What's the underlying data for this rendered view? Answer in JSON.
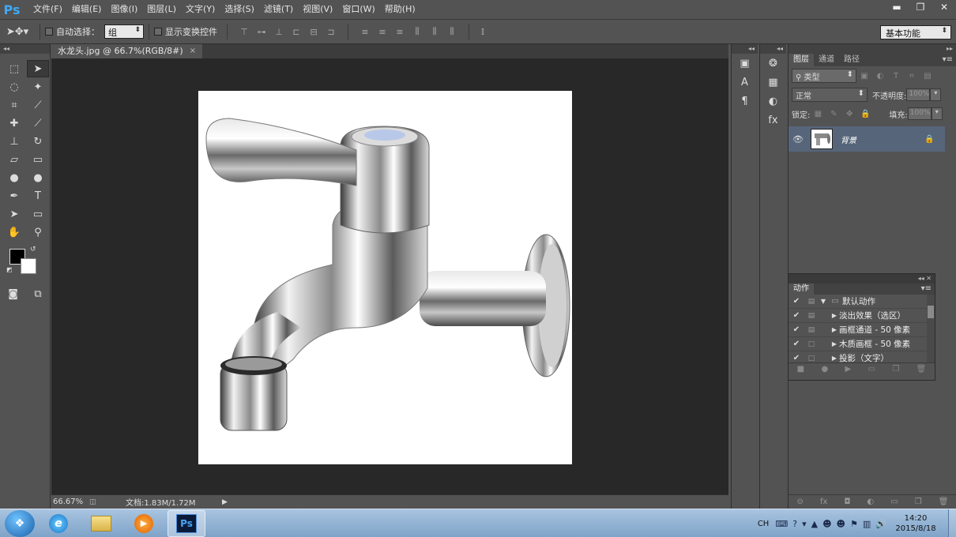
{
  "app": {
    "logo": "Ps"
  },
  "menu": [
    "文件(F)",
    "编辑(E)",
    "图像(I)",
    "图层(L)",
    "文字(Y)",
    "选择(S)",
    "滤镜(T)",
    "视图(V)",
    "窗口(W)",
    "帮助(H)"
  ],
  "window_controls": {
    "minimize": "▬",
    "restore": "❐",
    "close": "✕"
  },
  "options": {
    "tool_icon": "move-tool-icon",
    "auto_select_label": "自动选择：",
    "auto_select_value": "组",
    "show_transform_label": "显示变换控件",
    "workspace": "基本功能"
  },
  "document": {
    "tab_title": "水龙头.jpg @ 66.7%(RGB/8#)",
    "tab_close": "×",
    "zoom": "66.67%",
    "doc_info": "文档:1.83M/1.72M"
  },
  "layers_panel": {
    "tabs": [
      "图层",
      "通道",
      "路径"
    ],
    "filter_kind": "类型",
    "blend_mode": "正常",
    "opacity_label": "不透明度:",
    "opacity_value": "100%",
    "lock_label": "锁定:",
    "fill_label": "填充:",
    "fill_value": "100%",
    "layers": [
      {
        "name": "背景",
        "visible": true,
        "locked": true,
        "selected": true
      }
    ]
  },
  "actions_panel": {
    "title": "动作",
    "items": [
      {
        "label": "默认动作",
        "type": "set",
        "checked": true,
        "expanded": true
      },
      {
        "label": "淡出效果（选区）",
        "type": "action",
        "checked": true,
        "dialog": true
      },
      {
        "label": "画框通道 - 50 像素",
        "type": "action",
        "checked": true,
        "dialog": true
      },
      {
        "label": "木质画框 - 50 像素",
        "type": "action",
        "checked": true,
        "dialog": false
      },
      {
        "label": "投影（文字）",
        "type": "action",
        "checked": true,
        "dialog": false
      }
    ]
  },
  "taskbar": {
    "ime": "CH",
    "clock_time": "14:20",
    "clock_date": "2015/8/18"
  },
  "colors": {
    "ui_bg": "#535353",
    "canvas_bg": "#282828",
    "selected_layer": "#56657a",
    "foreground": "#000000",
    "background": "#ffffff"
  }
}
